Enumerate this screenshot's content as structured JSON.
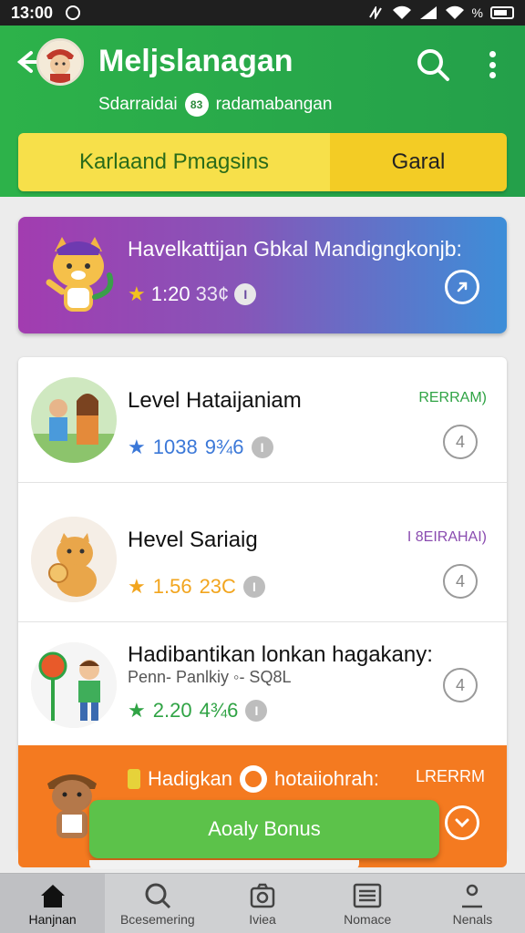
{
  "status_bar": {
    "time": "13:00",
    "battery_text": "%"
  },
  "app_bar": {
    "title": "Meljslanagan",
    "subtitle": "Sdarraidai",
    "subtitle_badge": "83",
    "subtitle_suffix": "radamabangan"
  },
  "tabs": [
    {
      "label": "Karlaand Pmagsins",
      "active": true
    },
    {
      "label": "Garal",
      "active": false
    }
  ],
  "featured": {
    "title": "Havelkattijan Gbkal Mandigngkonjb:",
    "rating": "1:20",
    "rating_extra": "33¢"
  },
  "list": [
    {
      "title": "Level Hataijaniam",
      "tag": "RERRAM)",
      "tag_color": "#2fa344",
      "rating": "1038",
      "rating_extra": "9¾6",
      "star_color": "#3b78d8",
      "rating_color": "#3b78d8",
      "action": "4"
    },
    {
      "title": "Hevel Sariaig",
      "tag": "I 8EIRAHAI)",
      "tag_color": "#8a4cb0",
      "rating": "1.56",
      "rating_extra": "23C",
      "star_color": "#f2a51e",
      "rating_color": "#f2a51e",
      "action": "4"
    },
    {
      "title": "Hadibantikan lonkan hagakany:",
      "sub": "Penn- Panlkiy ◦- SQ8L",
      "rating": "2.20",
      "rating_extra": "4¾6",
      "star_color": "#2fa344",
      "rating_color": "#2fa344",
      "action": "4"
    }
  ],
  "promo": {
    "title": "Hadigkan",
    "title_suffix": "hotaiiohrah:",
    "tag": "LRERRM",
    "button": "Aoaly Bonus"
  },
  "bottom_nav": [
    {
      "label": "Hanjnan",
      "icon": "home-icon",
      "active": true
    },
    {
      "label": "Bcesemering",
      "icon": "search-icon",
      "active": false
    },
    {
      "label": "Iviea",
      "icon": "camera-icon",
      "active": false
    },
    {
      "label": "Nomace",
      "icon": "list-icon",
      "active": false
    },
    {
      "label": "Nenals",
      "icon": "profile-icon",
      "active": false
    }
  ],
  "colors": {
    "appbar": "#2db24a",
    "tab_active": "#f7e04a",
    "promo": "#f47a20",
    "button": "#5cc24a"
  }
}
